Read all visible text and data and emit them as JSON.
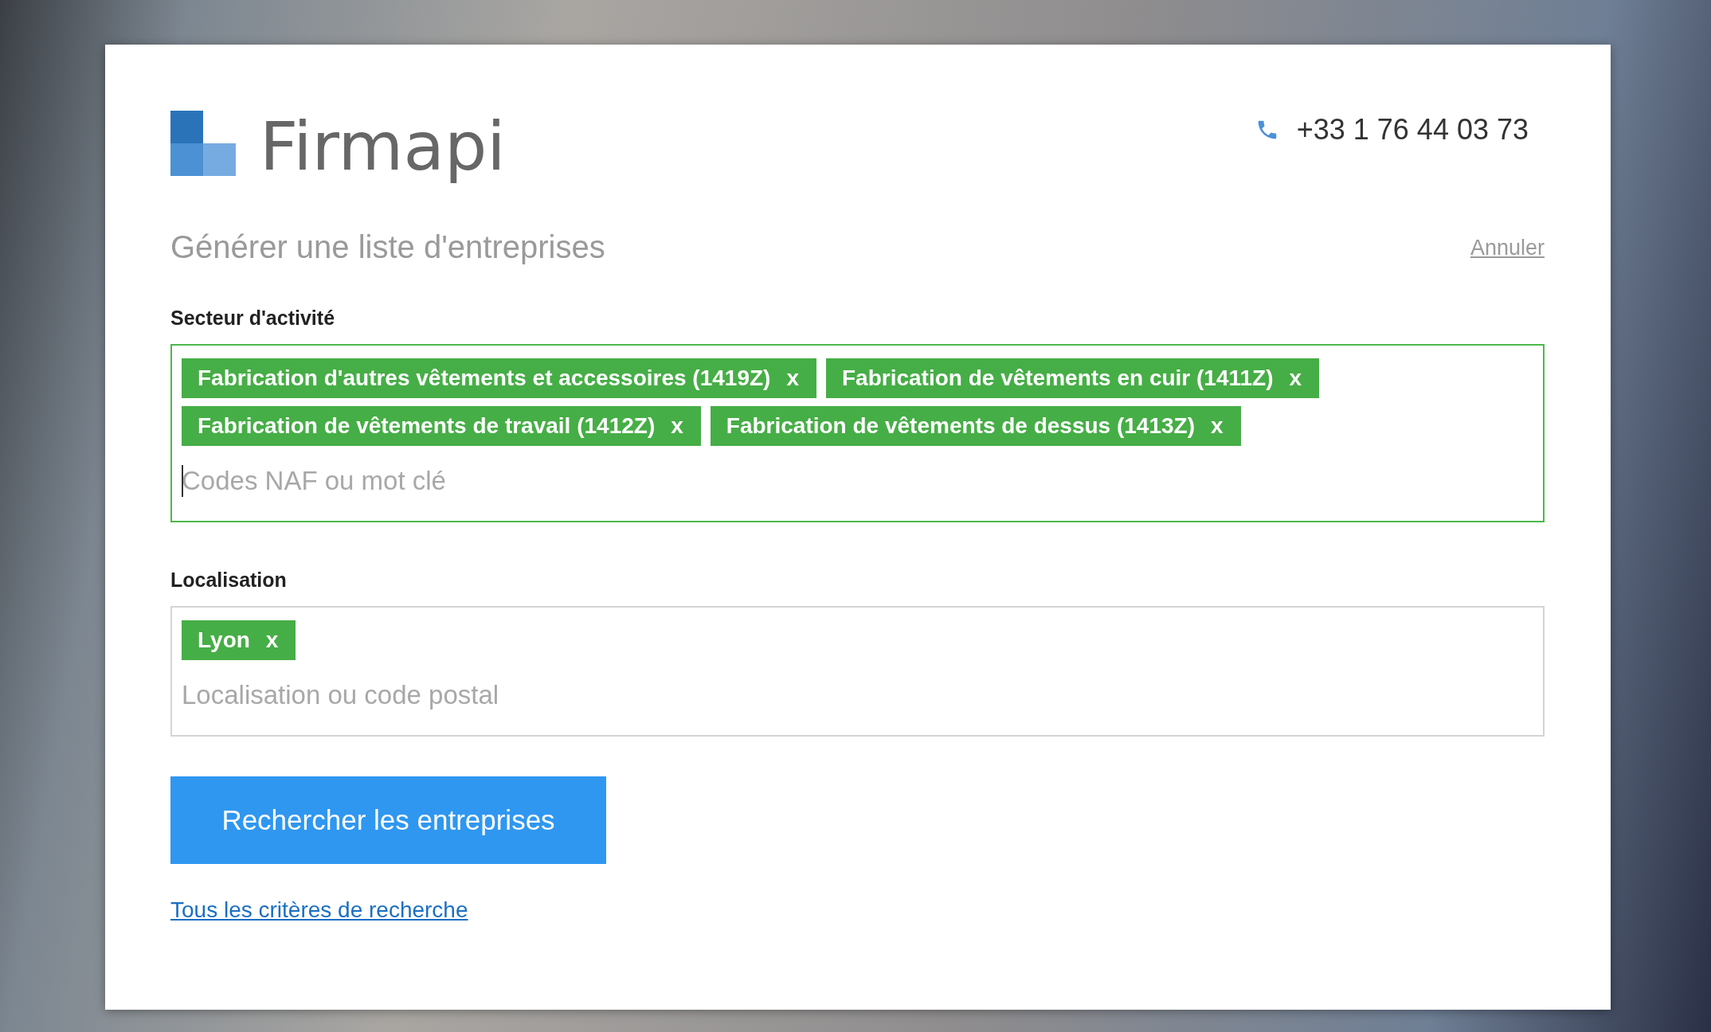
{
  "header": {
    "brand": "Firmapi",
    "phone": "+33 1 76 44 03 73"
  },
  "form": {
    "title": "Générer une liste d'entreprises",
    "cancel_link": "Annuler",
    "fields": [
      {
        "label": "Secteur d'activité",
        "focused": true,
        "placeholder": "Codes NAF ou mot clé",
        "tags": [
          {
            "text": "Fabrication d'autres vêtements et accessoires (1419Z)",
            "remove": "x"
          },
          {
            "text": "Fabrication de vêtements en cuir (1411Z)",
            "remove": "x"
          },
          {
            "text": "Fabrication de vêtements de travail (1412Z)",
            "remove": "x"
          },
          {
            "text": "Fabrication de vêtements de dessus (1413Z)",
            "remove": "x"
          }
        ]
      },
      {
        "label": "Localisation",
        "focused": false,
        "placeholder": "Localisation ou code postal",
        "tags": [
          {
            "text": "Lyon",
            "remove": "x"
          }
        ]
      }
    ],
    "submit_button": "Rechercher les entreprises",
    "all_criteria_link": "Tous les critères de recherche"
  }
}
